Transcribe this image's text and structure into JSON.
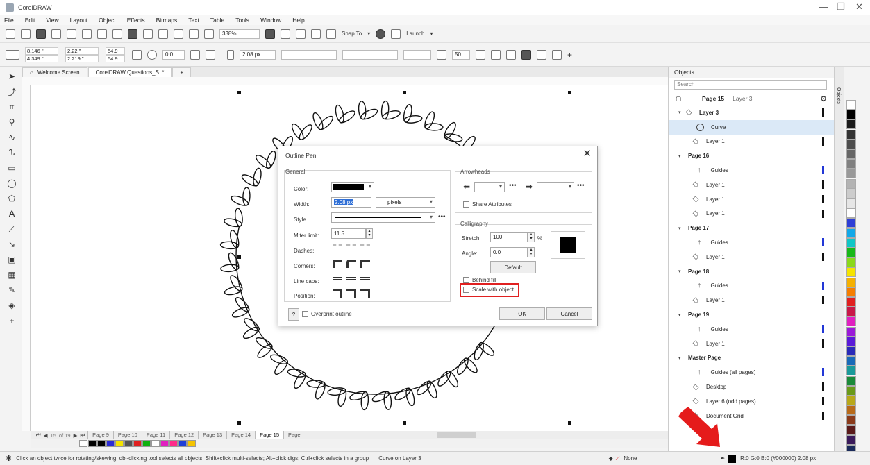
{
  "window": {
    "title": "CorelDRAW"
  },
  "menu": [
    "File",
    "Edit",
    "View",
    "Layout",
    "Object",
    "Effects",
    "Bitmaps",
    "Text",
    "Table",
    "Tools",
    "Window",
    "Help"
  ],
  "toolbar": {
    "zoom": "338%",
    "snap_to": "Snap To",
    "launch": "Launch"
  },
  "propbar": {
    "x": "8.146 \"",
    "y": "4.349 \"",
    "w": "2.22 \"",
    "h": "2.219 \"",
    "sx": "54.9",
    "sy": "54.9",
    "angle": "0.0",
    "outline_width": "2.08 px",
    "smooth": "50"
  },
  "tabs": {
    "welcome": "Welcome Screen",
    "document": "CorelDRAW Questions_S..*"
  },
  "dialog": {
    "title": "Outline Pen",
    "general": "General",
    "color_label": "Color:",
    "width_label": "Width:",
    "width_value": "2.08 px",
    "width_unit": "pixels",
    "style_label": "Style",
    "miter_label": "Miter limit:",
    "miter_value": "11.5",
    "dashes_label": "Dashes:",
    "corners_label": "Corners:",
    "linecaps_label": "Line caps:",
    "position_label": "Position:",
    "arrowheads": "Arrowheads",
    "share_attributes": "Share Attributes",
    "calligraphy": "Calligraphy",
    "stretch_label": "Stretch:",
    "stretch_value": "100",
    "angle_label": "Angle:",
    "angle_value": "0.0",
    "default_button": "Default",
    "behind_fill": "Behind fill",
    "scale_with_object": "Scale with object",
    "help": "?",
    "overprint": "Overprint outline",
    "ok": "OK",
    "cancel": "Cancel"
  },
  "pages": {
    "counter": "15",
    "of": "of 19",
    "tabs": [
      "Page 9",
      "Page 10",
      "Page 11",
      "Page 12",
      "Page 13",
      "Page 14",
      "Page 15",
      "Page"
    ]
  },
  "objects": {
    "title": "Objects",
    "search_placeholder": "Search",
    "header_page": "Page 15",
    "header_layer": "Layer 3",
    "rows": [
      {
        "label": "Layer 3",
        "bold": true
      },
      {
        "label": "Curve"
      },
      {
        "label": "Layer 1"
      },
      {
        "label": "Page 16",
        "bold": true
      },
      {
        "label": "Guides"
      },
      {
        "label": "Layer 1"
      },
      {
        "label": "Layer 1"
      },
      {
        "label": "Layer 1"
      },
      {
        "label": "Page 17",
        "bold": true
      },
      {
        "label": "Guides"
      },
      {
        "label": "Layer 1"
      },
      {
        "label": "Page 18",
        "bold": true
      },
      {
        "label": "Guides"
      },
      {
        "label": "Layer 1"
      },
      {
        "label": "Page 19",
        "bold": true
      },
      {
        "label": "Guides"
      },
      {
        "label": "Layer 1"
      },
      {
        "label": "Master Page",
        "bold": true
      },
      {
        "label": "Guides (all pages)"
      },
      {
        "label": "Desktop"
      },
      {
        "label": "Layer 6 (odd pages)"
      },
      {
        "label": "Document Grid"
      }
    ]
  },
  "status": {
    "hint": "Click an object twice for rotating/skewing; dbl-clicking tool selects all objects; Shift+click multi-selects; Alt+click digs; Ctrl+click selects in a group",
    "selection": "Curve on Layer 3",
    "fill": "None",
    "outline": "R:0 G:0 B:0 (#000000)  2.08 px"
  },
  "colors": {
    "highlight": "#e02020",
    "accent": "#2f6fd6",
    "arrow": "#e51b1b"
  }
}
